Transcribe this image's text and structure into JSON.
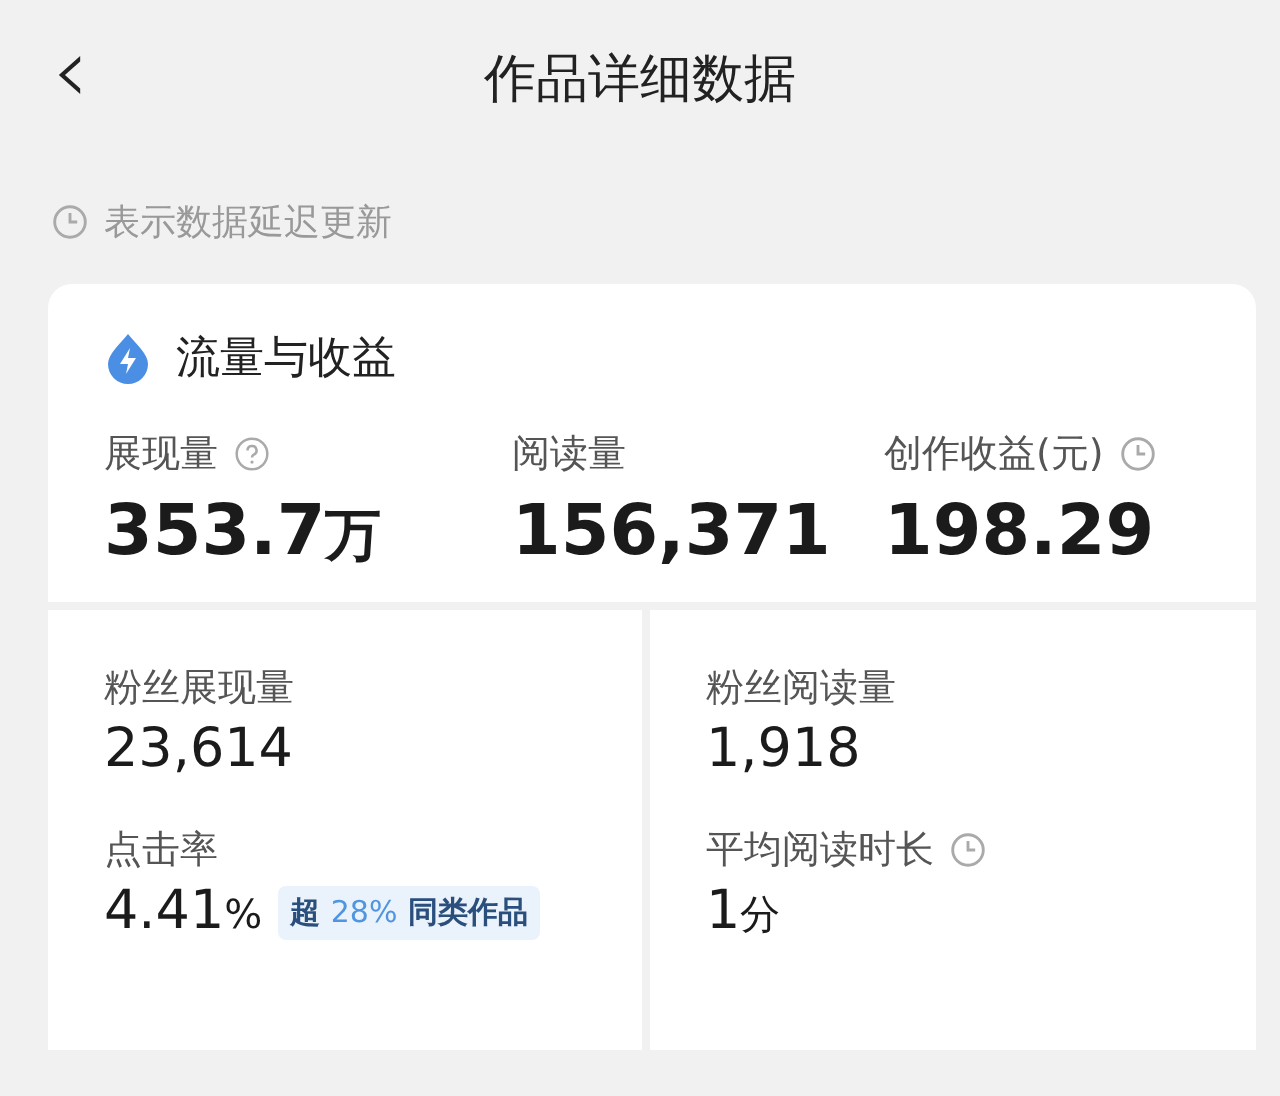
{
  "header": {
    "back": "‹",
    "title": "作品详细数据"
  },
  "notice": {
    "text": "表示数据延迟更新"
  },
  "summary": {
    "title": "流量与收益",
    "metrics": [
      {
        "kind": "help",
        "label": "展现量",
        "value": "353.7",
        "unit": "万"
      },
      {
        "kind": "plain",
        "label": "阅读量",
        "value": "156,371"
      },
      {
        "kind": "delayed",
        "label": "创作收益(元)",
        "value": "198.29"
      }
    ]
  },
  "panels": [
    {
      "metrics": [
        {
          "kind": "plain",
          "label": "粉丝展现量",
          "value": "23,614"
        },
        {
          "kind": "plain",
          "label": "点击率",
          "value": "4.41",
          "unit": "%",
          "badge": {
            "prefix": "超",
            "highlight": "28%",
            "suffix": "同类作品"
          }
        }
      ]
    },
    {
      "metrics": [
        {
          "kind": "plain",
          "label": "粉丝阅读量",
          "value": "1,918"
        },
        {
          "kind": "delayed",
          "label": "平均阅读时长",
          "value": "1",
          "unit": "分"
        }
      ]
    }
  ]
}
